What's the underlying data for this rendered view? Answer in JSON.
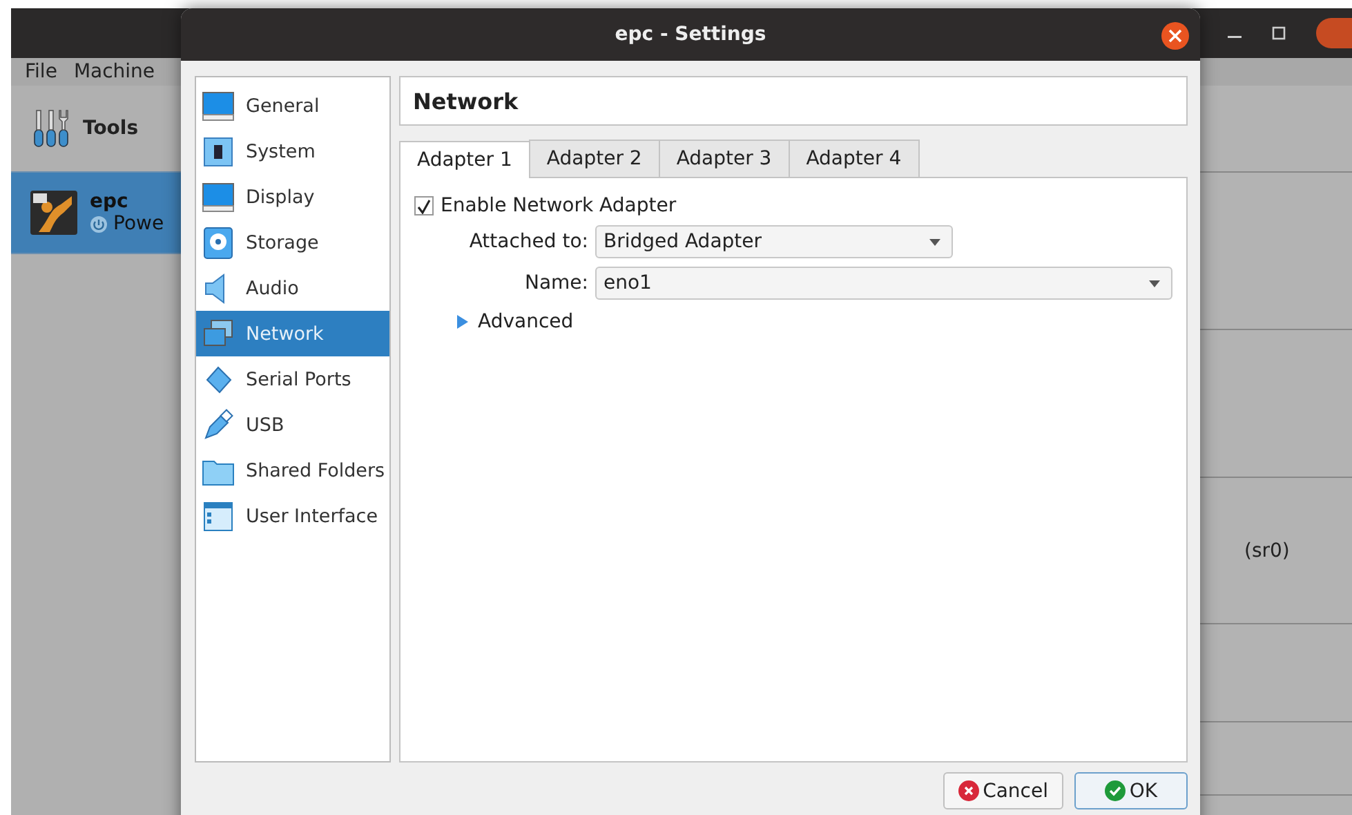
{
  "background_window": {
    "menu": [
      "File",
      "Machine"
    ],
    "tools_label": "Tools",
    "machines": [
      {
        "name": "epc",
        "state": "Powe",
        "selected": true
      }
    ],
    "detail_text": "(sr0)"
  },
  "dialog": {
    "title": "epc - Settings",
    "sections": [
      {
        "label": "General",
        "selected": false
      },
      {
        "label": "System",
        "selected": false
      },
      {
        "label": "Display",
        "selected": false
      },
      {
        "label": "Storage",
        "selected": false
      },
      {
        "label": "Audio",
        "selected": false
      },
      {
        "label": "Network",
        "selected": true
      },
      {
        "label": "Serial Ports",
        "selected": false
      },
      {
        "label": "USB",
        "selected": false
      },
      {
        "label": "Shared Folders",
        "selected": false
      },
      {
        "label": "User Interface",
        "selected": false
      }
    ],
    "header": "Network",
    "tabs": [
      {
        "label": "Adapter 1",
        "selected": true
      },
      {
        "label": "Adapter 2",
        "selected": false
      },
      {
        "label": "Adapter 3",
        "selected": false
      },
      {
        "label": "Adapter 4",
        "selected": false
      }
    ],
    "enable_adapter": {
      "label": "Enable Network Adapter",
      "checked": true
    },
    "attached_to": {
      "label": "Attached to:",
      "value": "Bridged Adapter"
    },
    "name": {
      "label": "Name:",
      "value": "eno1"
    },
    "advanced": {
      "label": "Advanced",
      "expanded": false
    },
    "buttons": [
      {
        "label": "Cancel",
        "kind": "cancel"
      },
      {
        "label": "OK",
        "kind": "ok"
      }
    ]
  }
}
